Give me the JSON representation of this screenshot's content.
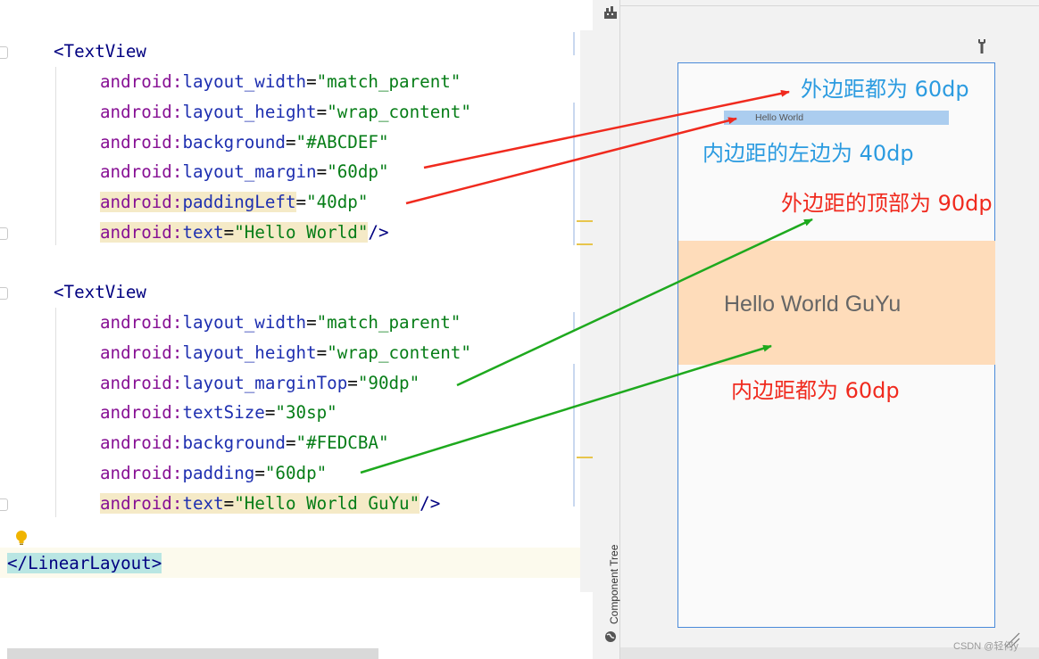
{
  "editor": {
    "block1": {
      "tag_open": "<TextView",
      "lines": [
        {
          "ns": "android",
          "attr": "layout_width",
          "value": "\"match_parent\"",
          "tail": ""
        },
        {
          "ns": "android",
          "attr": "layout_height",
          "value": "\"wrap_content\"",
          "tail": ""
        },
        {
          "ns": "android",
          "attr": "background",
          "value": "\"#ABCDEF\"",
          "tail": ""
        },
        {
          "ns": "android",
          "attr": "layout_margin",
          "value": "\"60dp\"",
          "tail": ""
        },
        {
          "ns": "android",
          "attr": "paddingLeft",
          "value": "\"40dp\"",
          "tail": ""
        },
        {
          "ns": "android",
          "attr": "text",
          "value": "\"Hello World\"",
          "tail": "/>"
        }
      ]
    },
    "block2": {
      "tag_open": "<TextView",
      "lines": [
        {
          "ns": "android",
          "attr": "layout_width",
          "value": "\"match_parent\"",
          "tail": ""
        },
        {
          "ns": "android",
          "attr": "layout_height",
          "value": "\"wrap_content\"",
          "tail": ""
        },
        {
          "ns": "android",
          "attr": "layout_marginTop",
          "value": "\"90dp\"",
          "tail": ""
        },
        {
          "ns": "android",
          "attr": "textSize",
          "value": "\"30sp\"",
          "tail": ""
        },
        {
          "ns": "android",
          "attr": "background",
          "value": "\"#FEDCBA\"",
          "tail": ""
        },
        {
          "ns": "android",
          "attr": "padding",
          "value": "\"60dp\"",
          "tail": ""
        },
        {
          "ns": "android",
          "attr": "text",
          "value": "\"Hello World GuYu\"",
          "tail": "/>"
        }
      ]
    },
    "closing_tag": "</LinearLayout>",
    "colors": {
      "namespace": "#871094",
      "attribute": "#1e2fb0",
      "value": "#067d17",
      "tag": "#000080",
      "highlight": "#f5eac7"
    }
  },
  "preview": {
    "component_tree_label": "Component Tree",
    "textview1": {
      "text": "Hello World",
      "background": "#ABCDEF"
    },
    "textview2": {
      "text": "Hello World GuYu",
      "background": "#FEDCBA"
    },
    "icons": [
      "palette-icon",
      "wrench-icon",
      "globe-icon",
      "resize-icon"
    ]
  },
  "annotations": {
    "margin_all": "外边距都为 60dp",
    "padding_left": "内边距的左边为 40dp",
    "margin_top": "外边距的顶部为 90dp",
    "padding_all": "内边距都为 60dp",
    "colors": {
      "blue": "#2b9be0",
      "red": "#f02a1e",
      "green": "#1ea91e"
    }
  },
  "watermark": "CSDN @轻何y"
}
